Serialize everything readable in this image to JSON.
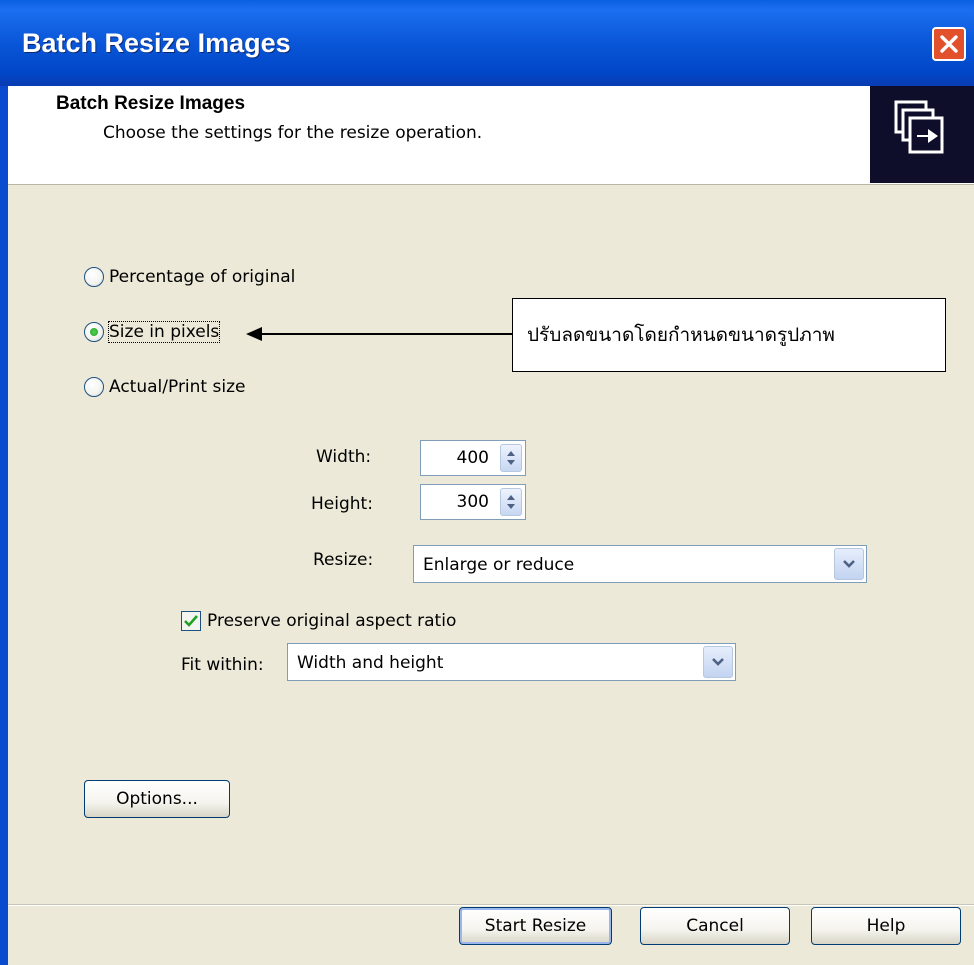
{
  "window": {
    "title": "Batch Resize Images"
  },
  "header": {
    "title": "Batch Resize Images",
    "subtitle": "Choose the settings for the resize operation."
  },
  "mode_options": [
    {
      "label": "Percentage of original",
      "checked": false
    },
    {
      "label": "Size in pixels",
      "checked": true
    },
    {
      "label": "Actual/Print size",
      "checked": false
    }
  ],
  "annotation": {
    "text": "ปรับลดขนาดโดยกำหนดขนาดรูปภาพ"
  },
  "dimensions": {
    "width_label": "Width:",
    "width_value": "400",
    "height_label": "Height:",
    "height_value": "300"
  },
  "resize": {
    "label": "Resize:",
    "value": "Enlarge or reduce"
  },
  "preserve_aspect": {
    "label": "Preserve original aspect ratio",
    "checked": true
  },
  "fit_within": {
    "label": "Fit within:",
    "value": "Width and height"
  },
  "buttons": {
    "options": "Options...",
    "start": "Start Resize",
    "cancel": "Cancel",
    "help": "Help"
  }
}
